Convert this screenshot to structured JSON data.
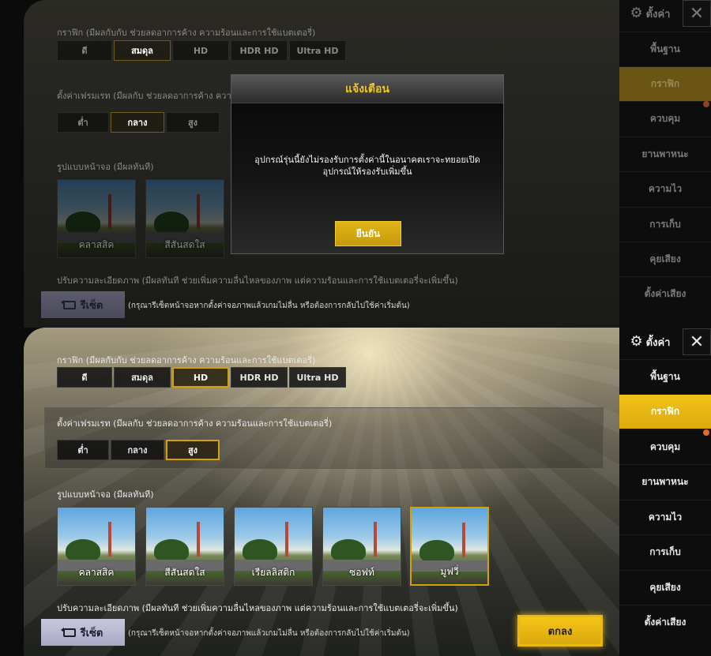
{
  "settings": {
    "graphics_label": "กราฟิก (มีผลกับกับ ช่วยลดอาการค้าง ความร้อนและการใช้แบตเตอรี่)",
    "graphics_options": [
      "ดี",
      "สมดุล",
      "HD",
      "HDR HD",
      "Ultra HD"
    ],
    "fps_label": "ตั้งค่าเฟรมเรท (มีผลกับ ช่วยลดอาการค้าง ความร้อนและการใช้แบตเตอรี่)",
    "fps_options": [
      "ต่ำ",
      "กลาง",
      "สูง"
    ],
    "style_label": "รูปแบบหน้าจอ (มีผลทันที)",
    "styles": [
      "คลาสสิค",
      "สีสันสดใส",
      "เรียลลิสติก",
      "ซอฟท์",
      "มูฟวี่"
    ],
    "brightness_label": "ปรับความละเอียดภาพ (มีผลทันที ช่วยเพิ่มความลื่นไหลของภาพ แต่ความร้อนและการใช้แบตเตอรี่จะเพิ่มขึ้น)",
    "reset_label": "รีเซ็ต",
    "reset_hint": "(กรุณารีเซ็ตหน้าจอหากตั้งค่าจอภาพแล้วเกมไม่ลื่น หรือต้องการกลับไปใช้ค่าเริ่มต้น)",
    "ok_label": "ตกลง"
  },
  "top": {
    "graphics_selected": 1,
    "fps_selected": 1
  },
  "bottom": {
    "graphics_selected": 2,
    "fps_selected": 2,
    "style_selected": 4
  },
  "sidebar": {
    "title": "ตั้งค่า",
    "close_icon": "close-icon",
    "gear_icon": "gear-icon",
    "items": [
      "พื้นฐาน",
      "กราฟิก",
      "ควบคุม",
      "ยานพาหนะ",
      "ความไว",
      "การเก็บ",
      "คุยเสียง",
      "ตั้งค่าเสียง"
    ],
    "active_index": 1,
    "notify_color": "#e8682c"
  },
  "modal": {
    "title": "แจ้งเตือน",
    "message": "อุปกรณ์รุ่นนี้ยังไม่รองรับการตั้งค่านี้ในอนาคตเราจะทยอยเปิดอุปกรณ์ให้รองรับเพิ่มขึ้น",
    "confirm_label": "ยืนยัน"
  },
  "colors": {
    "accent": "#f2c21a",
    "selected_border": "#d4a10c",
    "modal_title": "#f1c524"
  }
}
